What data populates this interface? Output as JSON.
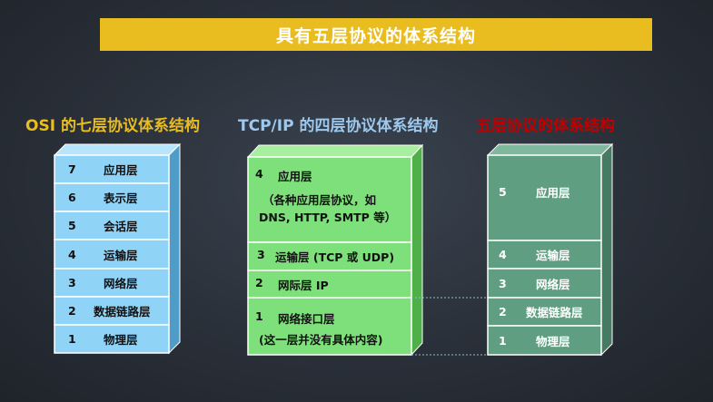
{
  "title": "具有五层协议的体系结构",
  "osi": {
    "title": "OSI 的七层协议体系结构",
    "layers": [
      {
        "num": "7",
        "name": "应用层"
      },
      {
        "num": "6",
        "name": "表示层"
      },
      {
        "num": "5",
        "name": "会话层"
      },
      {
        "num": "4",
        "name": "运输层"
      },
      {
        "num": "3",
        "name": "网络层"
      },
      {
        "num": "2",
        "name": "数据链路层"
      },
      {
        "num": "1",
        "name": "物理层"
      }
    ]
  },
  "tcpip": {
    "title": "TCP/IP 的四层协议体系结构",
    "layers": [
      {
        "num": "4",
        "name": "应用层",
        "note_line1": "（各种应用层协议，如",
        "note_line2": "DNS, HTTP, SMTP 等）"
      },
      {
        "num": "3",
        "name": "运输层 (TCP 或 UDP)"
      },
      {
        "num": "2",
        "name": "网际层 IP"
      },
      {
        "num": "1",
        "name": "网络接口层",
        "note_line1": "(这一层并没有具体内容)"
      }
    ]
  },
  "five": {
    "title": "五层协议的体系结构",
    "layers": [
      {
        "num": "5",
        "name": "应用层"
      },
      {
        "num": "4",
        "name": "运输层"
      },
      {
        "num": "3",
        "name": "网络层"
      },
      {
        "num": "2",
        "name": "数据链路层"
      },
      {
        "num": "1",
        "name": "物理层"
      }
    ]
  },
  "colors": {
    "osi_face": "#8fd3f7",
    "osi_side": "#4f9cc8",
    "tcp_face": "#7ee07a",
    "tcp_side": "#4fb04a",
    "five_face": "#5f9e80",
    "five_side": "#467a62",
    "title_bar": "#e9bd1f",
    "border": "#ffffff"
  }
}
